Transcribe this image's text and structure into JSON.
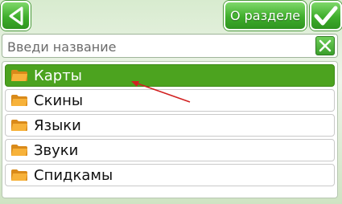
{
  "header": {
    "back_icon": "back-triangle-icon",
    "about_label": "О разделе",
    "confirm_icon": "checkmark-icon"
  },
  "search": {
    "placeholder": "Введи название",
    "value": "",
    "clear_icon": "close-x-icon"
  },
  "list": {
    "items": [
      {
        "label": "Карты",
        "icon": "folder-icon",
        "selected": true
      },
      {
        "label": "Скины",
        "icon": "folder-icon",
        "selected": false
      },
      {
        "label": "Языки",
        "icon": "folder-icon",
        "selected": false
      },
      {
        "label": "Звуки",
        "icon": "folder-icon",
        "selected": false
      },
      {
        "label": "Спидкамы",
        "icon": "folder-icon",
        "selected": false
      }
    ]
  },
  "colors": {
    "accent_green": "#4ca31f",
    "annotation_red": "#d22020"
  }
}
